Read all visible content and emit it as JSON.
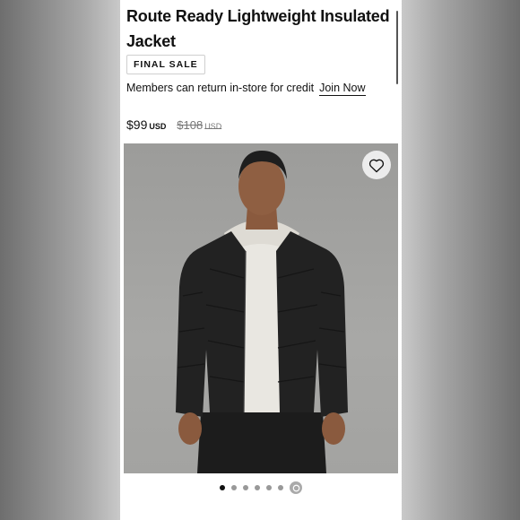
{
  "product": {
    "title": "Route Ready Lightweight Insulated Jacket",
    "badge": "FINAL SALE",
    "members_text": "Members can return in-store for credit",
    "join_link": "Join Now",
    "price": "$99",
    "price_currency": "USD",
    "old_price": "$108",
    "old_currency": "USD"
  },
  "gallery": {
    "image_count": 6,
    "active_index": 0,
    "favorite_icon": "heart-icon",
    "extra_icon": "view-360-icon"
  },
  "colors": {
    "background": "#ffffff",
    "text": "#111111",
    "muted": "#777777"
  }
}
